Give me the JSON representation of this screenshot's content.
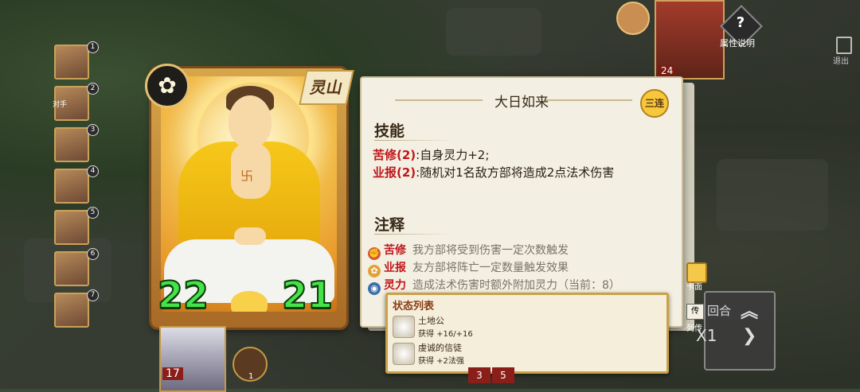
{
  "hero_card": {
    "faction": "灵山",
    "attack": "22",
    "health": "21",
    "emblem_icon": "flower-emblem-icon",
    "body_symbol": "卐"
  },
  "detail": {
    "title": "大日如来",
    "combo_badge": "三连",
    "skills_header": "技能",
    "skills": [
      {
        "name": "苦修(2)",
        "text": ":自身灵力+2;"
      },
      {
        "name": "业报(2)",
        "text": ":随机对1名敌方部将造成2点法术伤害"
      }
    ],
    "notes_header": "注释",
    "notes": [
      {
        "icon": "muscle-icon",
        "name": "苦修",
        "text": "我方部将受到伤害一定次数触发"
      },
      {
        "icon": "lotus-icon",
        "name": "业报",
        "text": "友方部将阵亡一定数量触发效果"
      },
      {
        "icon": "spirit-icon",
        "name": "灵力",
        "text": "造成法术伤害时额外附加灵力（当前：8）"
      }
    ]
  },
  "status_list": {
    "header": "状态列表",
    "items": [
      {
        "name": "土地公",
        "desc": "获得 +16/+16"
      },
      {
        "name": "虔诚的信徒",
        "desc": "获得 +2法强"
      }
    ]
  },
  "roster": {
    "numbers": [
      "1",
      "2",
      "3",
      "4",
      "5",
      "6",
      "7"
    ],
    "opponent_label": "对手"
  },
  "hud": {
    "help_label": "属性说明",
    "exit_label": "退出",
    "top_portrait_count": "24",
    "cardface_label": "卡面",
    "liezhuan_icon": "传",
    "liezhuan_label": "列传",
    "round_label": "回合",
    "speed_label": "X1",
    "bottom_count": "17",
    "coin_value": "1",
    "bottom_numbers": [
      "3",
      "5"
    ]
  },
  "colors": {
    "skill_name": "#c0161a",
    "stat_green": "#45e24a",
    "panel_bg": "#f3efe2",
    "status_border": "#c9a248"
  }
}
